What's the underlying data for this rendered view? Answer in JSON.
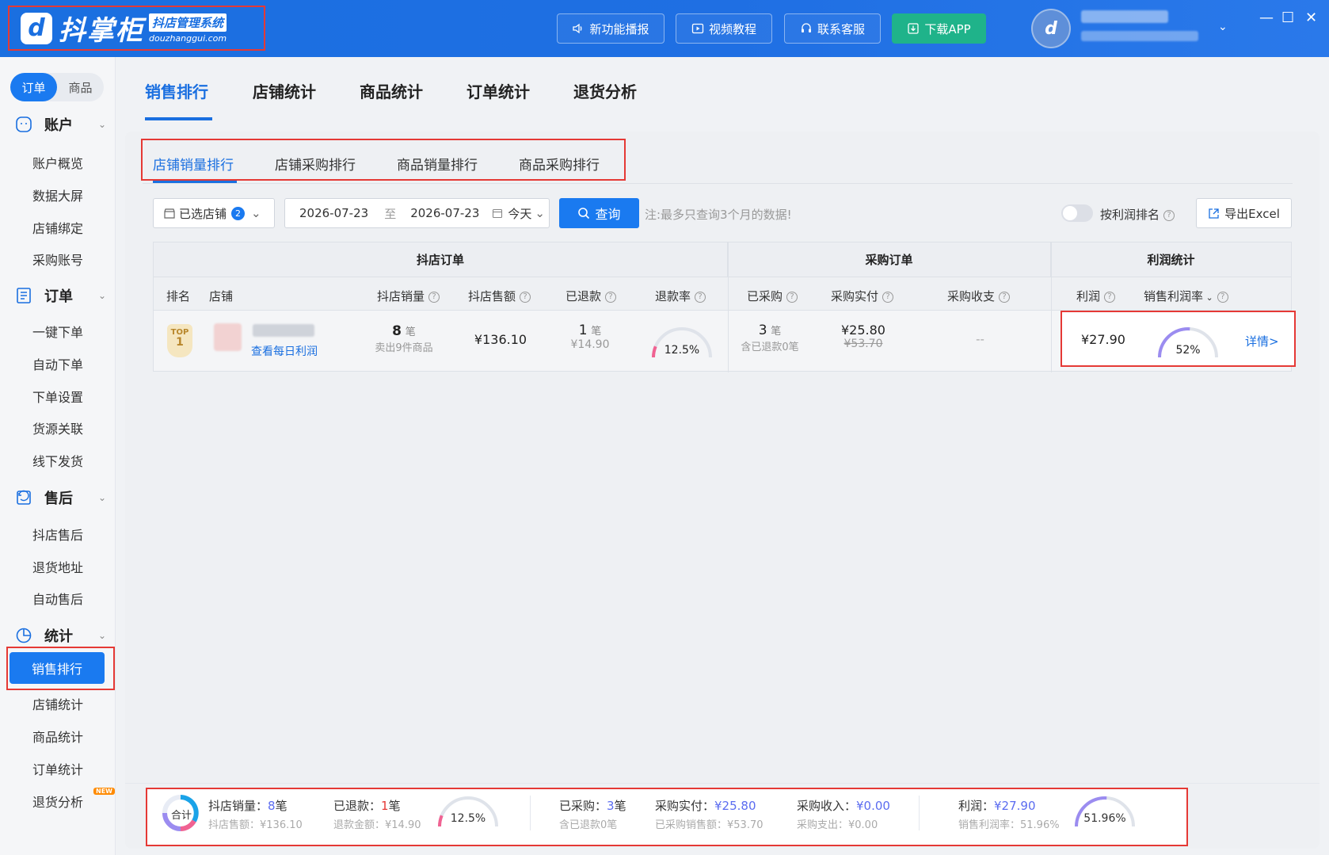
{
  "app": {
    "logo_mark": "d",
    "logo_name": "抖掌柜",
    "logo_tag": "抖店管理系统",
    "logo_url": "douzhanggui.com",
    "header_buttons": [
      "新功能播报",
      "视频教程",
      "联系客服",
      "下载APP"
    ],
    "win_min": "—",
    "win_max": "☐",
    "win_close": "✕"
  },
  "sidebar": {
    "segment": [
      "订单",
      "商品"
    ],
    "groups": {
      "account": "账户",
      "order": "订单",
      "aftersale": "售后",
      "stats": "统计"
    },
    "account_items": [
      "账户概览",
      "数据大屏",
      "店铺绑定",
      "采购账号"
    ],
    "order_items": [
      "一键下单",
      "自动下单",
      "下单设置",
      "货源关联",
      "线下发货"
    ],
    "aftersale_items": [
      "抖店售后",
      "退货地址",
      "自动售后"
    ],
    "stats_items": [
      "销售排行",
      "店铺统计",
      "商品统计",
      "订单统计",
      "退货分析"
    ],
    "new_badge": "NEW"
  },
  "top_tabs": [
    "销售排行",
    "店铺统计",
    "商品统计",
    "订单统计",
    "退货分析"
  ],
  "sub_tabs": [
    "店铺销量排行",
    "店铺采购排行",
    "商品销量排行",
    "商品采购排行"
  ],
  "filters": {
    "shop_select": "已选店铺",
    "shop_count": "2",
    "date_start": "2026-07-23",
    "date_sep": "至",
    "date_end": "2026-07-23",
    "date_preset": "今天",
    "query_button": "查询",
    "note": "注:最多只查询3个月的数据!",
    "profit_sort_label": "按利润排名",
    "export_button": "导出Excel"
  },
  "table": {
    "groups": [
      "抖店订单",
      "采购订单",
      "利润统计"
    ],
    "columns": {
      "rank": "排名",
      "shop": "店铺",
      "sales_qty": "抖店销量",
      "sales_amount": "抖店售额",
      "refunded": "已退款",
      "refund_rate": "退款率",
      "purchased": "已采购",
      "purchase_paid": "采购实付",
      "purchase_balance": "采购收支",
      "profit": "利润",
      "profit_rate": "销售利润率"
    },
    "row": {
      "rank_top": "TOP",
      "rank_num": "1",
      "shop_link": "查看每日利润",
      "sales_qty": "8",
      "unit_bi": "笔",
      "sold_items": "卖出9件商品",
      "sales_amount": "¥136.10",
      "refunded_qty": "1",
      "refunded_amount": "¥14.90",
      "refund_rate": "12.5%",
      "refund_rate_value": 12.5,
      "purchased_qty": "3",
      "purchased_sub": "含已退款0笔",
      "purchase_paid": "¥25.80",
      "purchase_orig": "¥53.70",
      "purchase_balance": "--",
      "profit": "¥27.90",
      "profit_rate": "52%",
      "profit_rate_value": 52,
      "detail_link": "详情>"
    }
  },
  "summary": {
    "total_label": "合计",
    "sales_qty_label": "抖店销量：",
    "sales_qty": "8",
    "unit_bi": "笔",
    "sales_amount": "抖店售额：¥136.10",
    "refunded_label": "已退款：",
    "refunded_qty": "1",
    "refund_amount": "退款金额：¥14.90",
    "refund_rate": "12.5%",
    "refund_rate_value": 12.5,
    "purchased_label": "已采购：",
    "purchased_qty": "3",
    "purchased_sub": "含已退款0笔",
    "purchase_paid_label": "采购实付：",
    "purchase_paid": "¥25.80",
    "purchase_sales": "已采购销售额：¥53.70",
    "purchase_income_label": "采购收入：",
    "purchase_income": "¥0.00",
    "purchase_expense": "采购支出：¥0.00",
    "profit_label": "利润：",
    "profit": "¥27.90",
    "profit_rate_text": "销售利润率：51.96%",
    "profit_rate": "51.96%",
    "profit_rate_value": 51.96
  },
  "colors": {
    "primary": "#1a7af0",
    "highlight_frame": "#e53935",
    "gauge_refund": "#f06292",
    "gauge_profit": "#9b8cf0"
  }
}
